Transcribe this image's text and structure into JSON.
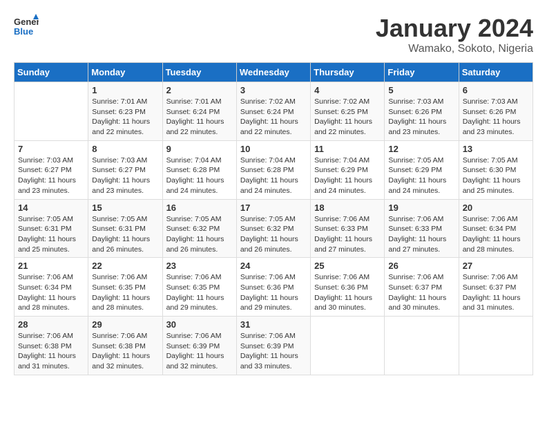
{
  "header": {
    "logo_line1": "General",
    "logo_line2": "Blue",
    "title": "January 2024",
    "subtitle": "Wamako, Sokoto, Nigeria"
  },
  "days_of_week": [
    "Sunday",
    "Monday",
    "Tuesday",
    "Wednesday",
    "Thursday",
    "Friday",
    "Saturday"
  ],
  "weeks": [
    [
      {
        "day": "",
        "info": ""
      },
      {
        "day": "1",
        "info": "Sunrise: 7:01 AM\nSunset: 6:23 PM\nDaylight: 11 hours\nand 22 minutes."
      },
      {
        "day": "2",
        "info": "Sunrise: 7:01 AM\nSunset: 6:24 PM\nDaylight: 11 hours\nand 22 minutes."
      },
      {
        "day": "3",
        "info": "Sunrise: 7:02 AM\nSunset: 6:24 PM\nDaylight: 11 hours\nand 22 minutes."
      },
      {
        "day": "4",
        "info": "Sunrise: 7:02 AM\nSunset: 6:25 PM\nDaylight: 11 hours\nand 22 minutes."
      },
      {
        "day": "5",
        "info": "Sunrise: 7:03 AM\nSunset: 6:26 PM\nDaylight: 11 hours\nand 23 minutes."
      },
      {
        "day": "6",
        "info": "Sunrise: 7:03 AM\nSunset: 6:26 PM\nDaylight: 11 hours\nand 23 minutes."
      }
    ],
    [
      {
        "day": "7",
        "info": "Sunrise: 7:03 AM\nSunset: 6:27 PM\nDaylight: 11 hours\nand 23 minutes."
      },
      {
        "day": "8",
        "info": "Sunrise: 7:03 AM\nSunset: 6:27 PM\nDaylight: 11 hours\nand 23 minutes."
      },
      {
        "day": "9",
        "info": "Sunrise: 7:04 AM\nSunset: 6:28 PM\nDaylight: 11 hours\nand 24 minutes."
      },
      {
        "day": "10",
        "info": "Sunrise: 7:04 AM\nSunset: 6:28 PM\nDaylight: 11 hours\nand 24 minutes."
      },
      {
        "day": "11",
        "info": "Sunrise: 7:04 AM\nSunset: 6:29 PM\nDaylight: 11 hours\nand 24 minutes."
      },
      {
        "day": "12",
        "info": "Sunrise: 7:05 AM\nSunset: 6:29 PM\nDaylight: 11 hours\nand 24 minutes."
      },
      {
        "day": "13",
        "info": "Sunrise: 7:05 AM\nSunset: 6:30 PM\nDaylight: 11 hours\nand 25 minutes."
      }
    ],
    [
      {
        "day": "14",
        "info": "Sunrise: 7:05 AM\nSunset: 6:31 PM\nDaylight: 11 hours\nand 25 minutes."
      },
      {
        "day": "15",
        "info": "Sunrise: 7:05 AM\nSunset: 6:31 PM\nDaylight: 11 hours\nand 26 minutes."
      },
      {
        "day": "16",
        "info": "Sunrise: 7:05 AM\nSunset: 6:32 PM\nDaylight: 11 hours\nand 26 minutes."
      },
      {
        "day": "17",
        "info": "Sunrise: 7:05 AM\nSunset: 6:32 PM\nDaylight: 11 hours\nand 26 minutes."
      },
      {
        "day": "18",
        "info": "Sunrise: 7:06 AM\nSunset: 6:33 PM\nDaylight: 11 hours\nand 27 minutes."
      },
      {
        "day": "19",
        "info": "Sunrise: 7:06 AM\nSunset: 6:33 PM\nDaylight: 11 hours\nand 27 minutes."
      },
      {
        "day": "20",
        "info": "Sunrise: 7:06 AM\nSunset: 6:34 PM\nDaylight: 11 hours\nand 28 minutes."
      }
    ],
    [
      {
        "day": "21",
        "info": "Sunrise: 7:06 AM\nSunset: 6:34 PM\nDaylight: 11 hours\nand 28 minutes."
      },
      {
        "day": "22",
        "info": "Sunrise: 7:06 AM\nSunset: 6:35 PM\nDaylight: 11 hours\nand 28 minutes."
      },
      {
        "day": "23",
        "info": "Sunrise: 7:06 AM\nSunset: 6:35 PM\nDaylight: 11 hours\nand 29 minutes."
      },
      {
        "day": "24",
        "info": "Sunrise: 7:06 AM\nSunset: 6:36 PM\nDaylight: 11 hours\nand 29 minutes."
      },
      {
        "day": "25",
        "info": "Sunrise: 7:06 AM\nSunset: 6:36 PM\nDaylight: 11 hours\nand 30 minutes."
      },
      {
        "day": "26",
        "info": "Sunrise: 7:06 AM\nSunset: 6:37 PM\nDaylight: 11 hours\nand 30 minutes."
      },
      {
        "day": "27",
        "info": "Sunrise: 7:06 AM\nSunset: 6:37 PM\nDaylight: 11 hours\nand 31 minutes."
      }
    ],
    [
      {
        "day": "28",
        "info": "Sunrise: 7:06 AM\nSunset: 6:38 PM\nDaylight: 11 hours\nand 31 minutes."
      },
      {
        "day": "29",
        "info": "Sunrise: 7:06 AM\nSunset: 6:38 PM\nDaylight: 11 hours\nand 32 minutes."
      },
      {
        "day": "30",
        "info": "Sunrise: 7:06 AM\nSunset: 6:39 PM\nDaylight: 11 hours\nand 32 minutes."
      },
      {
        "day": "31",
        "info": "Sunrise: 7:06 AM\nSunset: 6:39 PM\nDaylight: 11 hours\nand 33 minutes."
      },
      {
        "day": "",
        "info": ""
      },
      {
        "day": "",
        "info": ""
      },
      {
        "day": "",
        "info": ""
      }
    ]
  ]
}
